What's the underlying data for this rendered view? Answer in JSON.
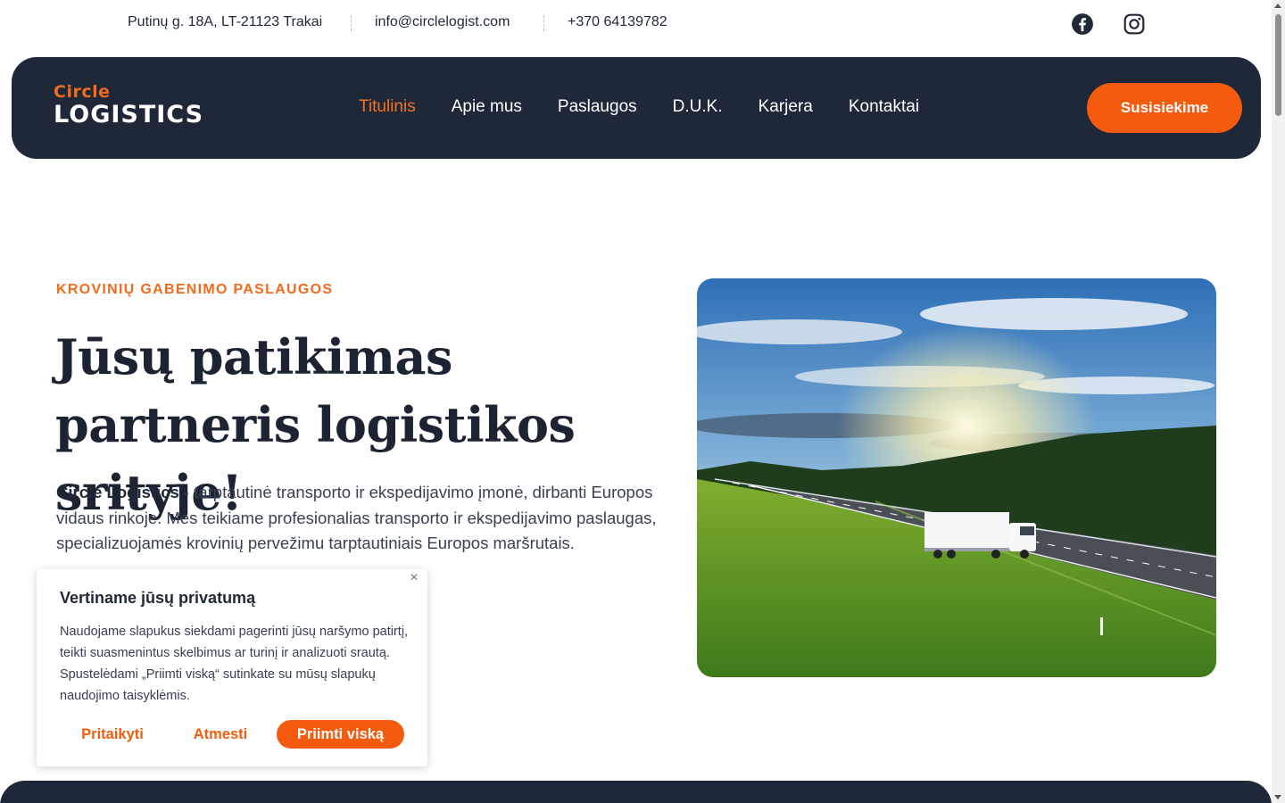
{
  "topbar": {
    "address": "Putinų g. 18A, LT-21123 Trakai",
    "email": "info@circlelogist.com",
    "phone": "+370 64139782",
    "social": [
      "facebook-icon",
      "instagram-icon"
    ]
  },
  "nav": {
    "logo_line1": "Circle",
    "logo_line2": "LOGISTICS",
    "items": [
      {
        "label": "Titulinis",
        "active": true
      },
      {
        "label": "Apie mus"
      },
      {
        "label": "Paslaugos"
      },
      {
        "label": "D.U.K."
      },
      {
        "label": "Karjera"
      },
      {
        "label": "Kontaktai"
      }
    ],
    "cta": "Susisiekime"
  },
  "hero": {
    "eyebrow": "KROVINIŲ GABENIMO PASLAUGOS",
    "headline": "Jūsų patikimas partneris logistikos srityje!",
    "company": "Circle Logistics",
    "body": " - tarptautinė transporto ir ekspedijavimo įmonė, dirbanti Europos vidaus rinkoje. Mes teikiame profesionalias transporto ir ekspedijavimo paslaugas, specializuojamės krovinių pervežimu tarptautiniais Europos maršrutais."
  },
  "cookie": {
    "title": "Vertiname jūsų privatumą",
    "text": "Naudojame slapukus siekdami pagerinti jūsų naršymo patirtį, teikti suasmenintus skelbimus ar turinį ir analizuoti srautą. Spustelėdami „Priimti viską“ sutinkate su mūsų slapukų naudojimo taisyklėmis.",
    "customize": "Pritaikyti",
    "reject": "Atmesti",
    "accept": "Priimti viską"
  },
  "colors": {
    "accent": "#f45b0e",
    "navy": "#1e2838"
  }
}
